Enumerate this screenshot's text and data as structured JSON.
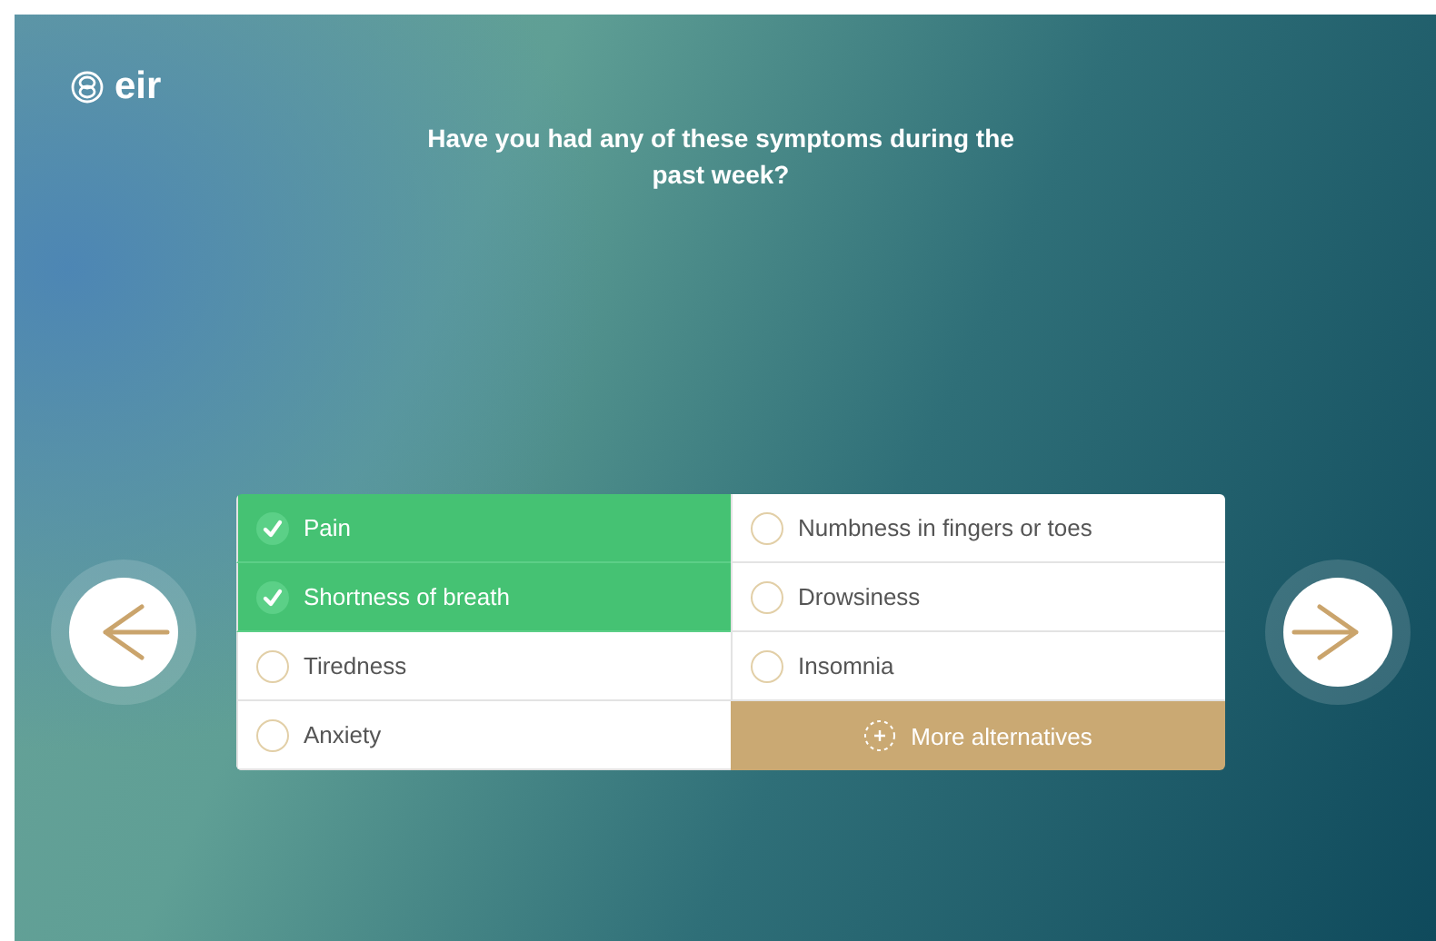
{
  "brand": {
    "name": "eir"
  },
  "question": "Have you had any of these symptoms during the past week?",
  "options": [
    {
      "label": "Pain",
      "checked": true
    },
    {
      "label": "Numbness in fingers or toes",
      "checked": false
    },
    {
      "label": "Shortness of breath",
      "checked": true
    },
    {
      "label": "Drowsiness",
      "checked": false
    },
    {
      "label": "Tiredness",
      "checked": false
    },
    {
      "label": "Insomnia",
      "checked": false
    },
    {
      "label": "Anxiety",
      "checked": false
    }
  ],
  "more_button": {
    "label": "More alternatives"
  }
}
